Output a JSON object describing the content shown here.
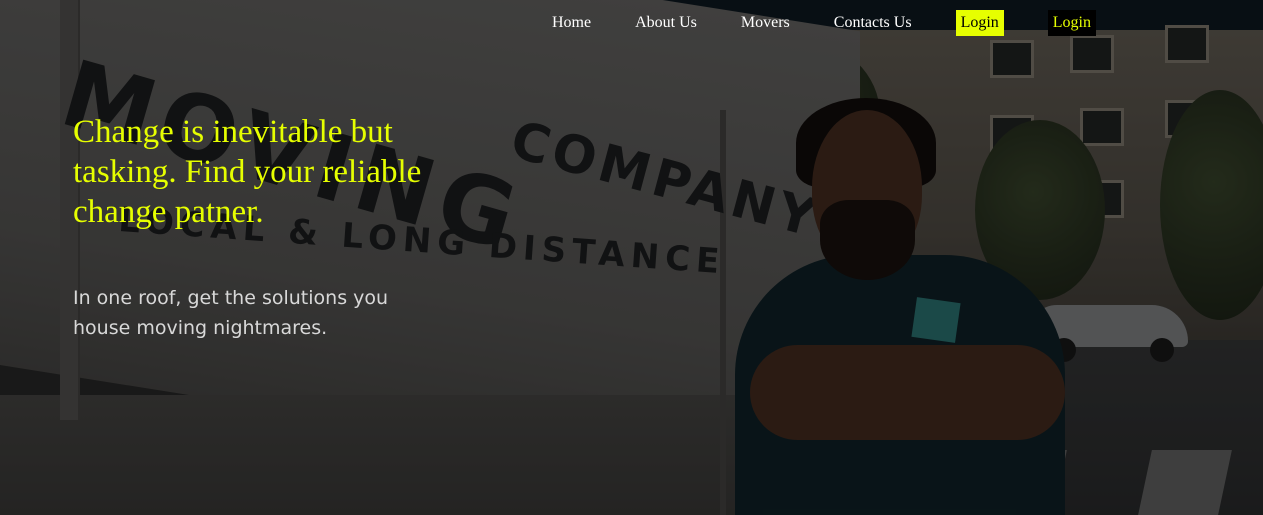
{
  "colors": {
    "accent": "#e6ff00",
    "nav_text": "#ffffff",
    "login_secondary_bg": "#000000",
    "subtitle_text": "#d8d8d8"
  },
  "nav": {
    "links": [
      "Home",
      "About Us",
      "Movers",
      "Contacts Us"
    ],
    "login_primary_label": "Login",
    "login_secondary_label": "Login"
  },
  "hero": {
    "title": "Change is inevitable but tasking. Find your reliable change patner.",
    "subtitle": "In one roof, get the solutions you house moving nightmares."
  },
  "background": {
    "van_text_line1": "MOVING",
    "van_text_line2": "COMPANY",
    "van_text_line3": "LOCAL & LONG DISTANCE"
  }
}
